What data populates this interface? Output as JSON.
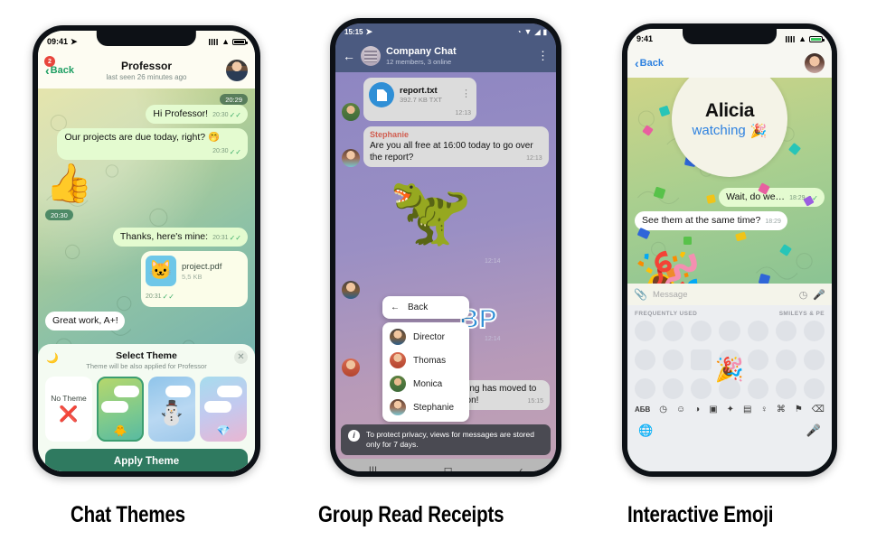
{
  "captions": [
    {
      "label": "Chat Themes"
    },
    {
      "label": "Group Read Receipts"
    },
    {
      "label": "Interactive Emoji"
    }
  ],
  "phone1": {
    "status": {
      "time": "09:41",
      "location_icon": "location-arrow-icon",
      "signal_icon": "signal-bars-icon",
      "wifi_icon": "wifi-icon",
      "battery_icon": "battery-icon"
    },
    "nav": {
      "back_label": "Back",
      "back_badge": "2",
      "title": "Professor",
      "subtitle": "last seen 26 minutes ago",
      "avatar": "professor-avatar"
    },
    "messages": [
      {
        "side": "out",
        "kind": "sticker",
        "emoji": "👍",
        "time": "20:29",
        "tick": "✓✓"
      },
      {
        "side": "out",
        "kind": "text",
        "text": "Hi Professor!",
        "time": "20:30",
        "tick": "✓✓"
      },
      {
        "side": "out",
        "kind": "text",
        "text": "Our projects are due today, right? 🤭",
        "time": "20:30",
        "tick": "✓✓"
      },
      {
        "side": "in",
        "kind": "sticker",
        "emoji": "👍",
        "time": "20:30"
      },
      {
        "side": "out",
        "kind": "text",
        "text": "Thanks, here's mine:",
        "time": "20:31",
        "tick": "✓✓"
      },
      {
        "side": "out",
        "kind": "file",
        "filename": "project.pdf",
        "filesize": "5,5 KB",
        "time": "20:31",
        "tick": "✓✓",
        "thumb": "🐱"
      },
      {
        "side": "in",
        "kind": "text",
        "text": "Great work, A+!",
        "time": ""
      }
    ],
    "sheet": {
      "moon_icon": "moon-icon",
      "close_icon": "close-icon",
      "title": "Select Theme",
      "subtitle": "Theme will be also applied for Professor",
      "themes": [
        {
          "name": "No Theme",
          "icon": "❌",
          "selected": false,
          "kind": "none"
        },
        {
          "name": "green-theme",
          "icon": "🐥",
          "selected": true,
          "kind": "swatch"
        },
        {
          "name": "snowman-theme",
          "icon": "⛄",
          "selected": false,
          "kind": "swatch"
        },
        {
          "name": "gem-theme",
          "icon": "💎",
          "selected": false,
          "kind": "swatch"
        },
        {
          "name": "pink-theme",
          "icon": "",
          "selected": false,
          "kind": "swatch"
        }
      ],
      "apply_label": "Apply Theme"
    }
  },
  "phone2": {
    "status": {
      "time": "15:15",
      "telegram_icon": "telegram-icon",
      "alarm_icon": "alarm-icon",
      "wifi_icon": "wifi-icon",
      "signal_icon": "signal-icon",
      "battery_icon": "battery-icon"
    },
    "nav": {
      "back_icon": "arrow-left-icon",
      "title": "Company Chat",
      "subtitle": "12 members, 3 online",
      "menu_icon": "more-vertical-icon"
    },
    "messages": [
      {
        "kind": "file",
        "filename": "report.txt",
        "filesize": "392.7 KB TXT",
        "time": "12:13"
      },
      {
        "kind": "text",
        "sender": "Stephanie",
        "text": "Are you all free at 16:00 today to go over the report?",
        "time": "12:13"
      },
      {
        "kind": "sticker",
        "time": "12:14"
      },
      {
        "kind": "sticker2",
        "time": "12:14"
      },
      {
        "kind": "text",
        "text": "Hey guys, the meeting has moved to 16:30 – see you soon!",
        "time": "15:15"
      }
    ],
    "read_menu": {
      "back_label": "Back",
      "back_icon": "arrow-left-icon",
      "viewers": [
        {
          "name": "Director"
        },
        {
          "name": "Thomas"
        },
        {
          "name": "Monica"
        },
        {
          "name": "Stephanie"
        }
      ]
    },
    "toast": {
      "icon": "info-icon",
      "text": "To protect privacy, views for messages are stored only for 7 days."
    },
    "navbar": {
      "recents_icon": "recents-icon",
      "home_icon": "home-icon",
      "back_icon": "back-icon"
    }
  },
  "phone3": {
    "status": {
      "time": "9:41",
      "signal_icon": "signal-bars-icon",
      "wifi_icon": "wifi-icon",
      "battery_icon": "battery-charging-icon"
    },
    "nav": {
      "back_label": "Back",
      "avatar": "alicia-avatar"
    },
    "popup": {
      "name": "Alicia",
      "status": "watching",
      "emoji": "🎉"
    },
    "messages": [
      {
        "side": "out",
        "text": "Wait, do we…",
        "time": "18:29",
        "tick": "✓✓"
      },
      {
        "side": "in",
        "text": "See them at the same time?",
        "time": "18:29"
      }
    ],
    "input": {
      "attach_icon": "paperclip-icon",
      "placeholder": "Message",
      "sticker_icon": "sticker-icon",
      "mic_icon": "microphone-icon"
    },
    "keyboard": {
      "section_left": "FREQUENTLY USED",
      "section_right": "SMILEYS & PE",
      "lang_label": "АБВ",
      "tabs": [
        "clock-icon",
        "smiley-icon",
        "bear-icon",
        "food-icon",
        "ball-icon",
        "car-icon",
        "bulb-icon",
        "hash-icon",
        "flag-icon"
      ],
      "backspace_icon": "backspace-icon",
      "globe_icon": "globe-icon",
      "mic_icon": "microphone-icon",
      "highlight_emoji": "🎉"
    }
  },
  "colors": {
    "accent_green": "#2f7a60",
    "ios_blue": "#2f82e0",
    "telegram_blue": "#2f8fd6",
    "android_header": "#4b5a80",
    "bubble_out": "#e4fbd0",
    "bubble_in": "#ffffff",
    "sender_name": "#d15f52"
  }
}
